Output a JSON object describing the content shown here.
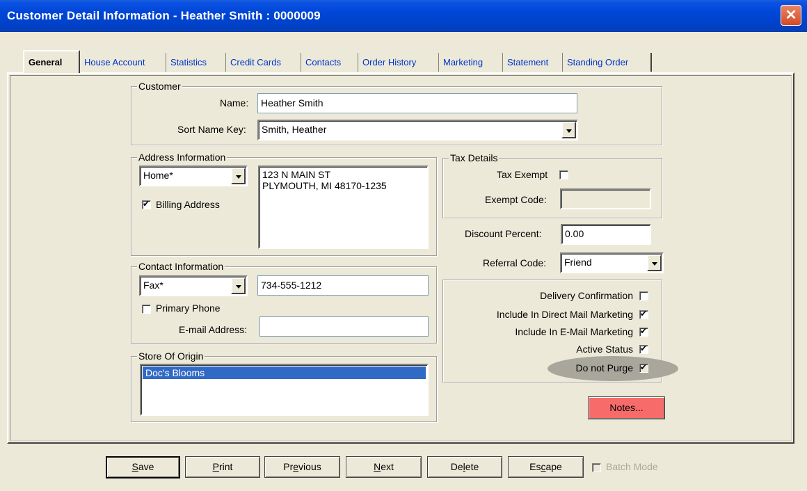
{
  "window": {
    "title": "Customer Detail Information - Heather Smith : 0000009",
    "close_label": "✕"
  },
  "tabs": [
    {
      "label": "General"
    },
    {
      "label": "House Account"
    },
    {
      "label": "Statistics"
    },
    {
      "label": "Credit Cards"
    },
    {
      "label": "Contacts"
    },
    {
      "label": "Order History"
    },
    {
      "label": "Marketing"
    },
    {
      "label": "Statement"
    },
    {
      "label": "Standing Order"
    }
  ],
  "customer": {
    "legend": "Customer",
    "name_label": "Name:",
    "name_value": "Heather Smith",
    "sort_label": "Sort Name Key:",
    "sort_value": "Smith, Heather"
  },
  "address": {
    "legend": "Address Information",
    "type_value": "Home*",
    "billing_label": "Billing Address",
    "billing_checked": true,
    "line1": "123 N MAIN ST",
    "line2": "PLYMOUTH, MI 48170-1235"
  },
  "contact": {
    "legend": "Contact Information",
    "type_value": "Fax*",
    "phone_value": "734-555-1212",
    "primary_label": "Primary Phone",
    "primary_checked": false,
    "email_label": "E-mail Address:",
    "email_value": ""
  },
  "store": {
    "legend": "Store Of Origin",
    "items": [
      "Doc's Blooms"
    ]
  },
  "tax": {
    "legend": "Tax Details",
    "exempt_label": "Tax Exempt",
    "exempt_checked": false,
    "code_label": "Exempt Code:",
    "code_value": ""
  },
  "discount": {
    "label": "Discount Percent:",
    "value": "0.00"
  },
  "referral": {
    "label": "Referral Code:",
    "value": "Friend"
  },
  "flags": [
    {
      "label": "Delivery Confirmation",
      "checked": false
    },
    {
      "label": "Include In Direct Mail Marketing",
      "checked": true
    },
    {
      "label": "Include In E-Mail Marketing",
      "checked": true
    },
    {
      "label": "Active Status",
      "checked": true
    },
    {
      "label": "Do not Purge",
      "checked": true
    }
  ],
  "notes_button": {
    "label": "Notes...",
    "color": "#f86b6b"
  },
  "footer": {
    "save": "Save",
    "print": "Print",
    "previous": "Previous",
    "next": "Next",
    "delete": "Delete",
    "escape": "Escape",
    "batch_mode": "Batch Mode"
  }
}
